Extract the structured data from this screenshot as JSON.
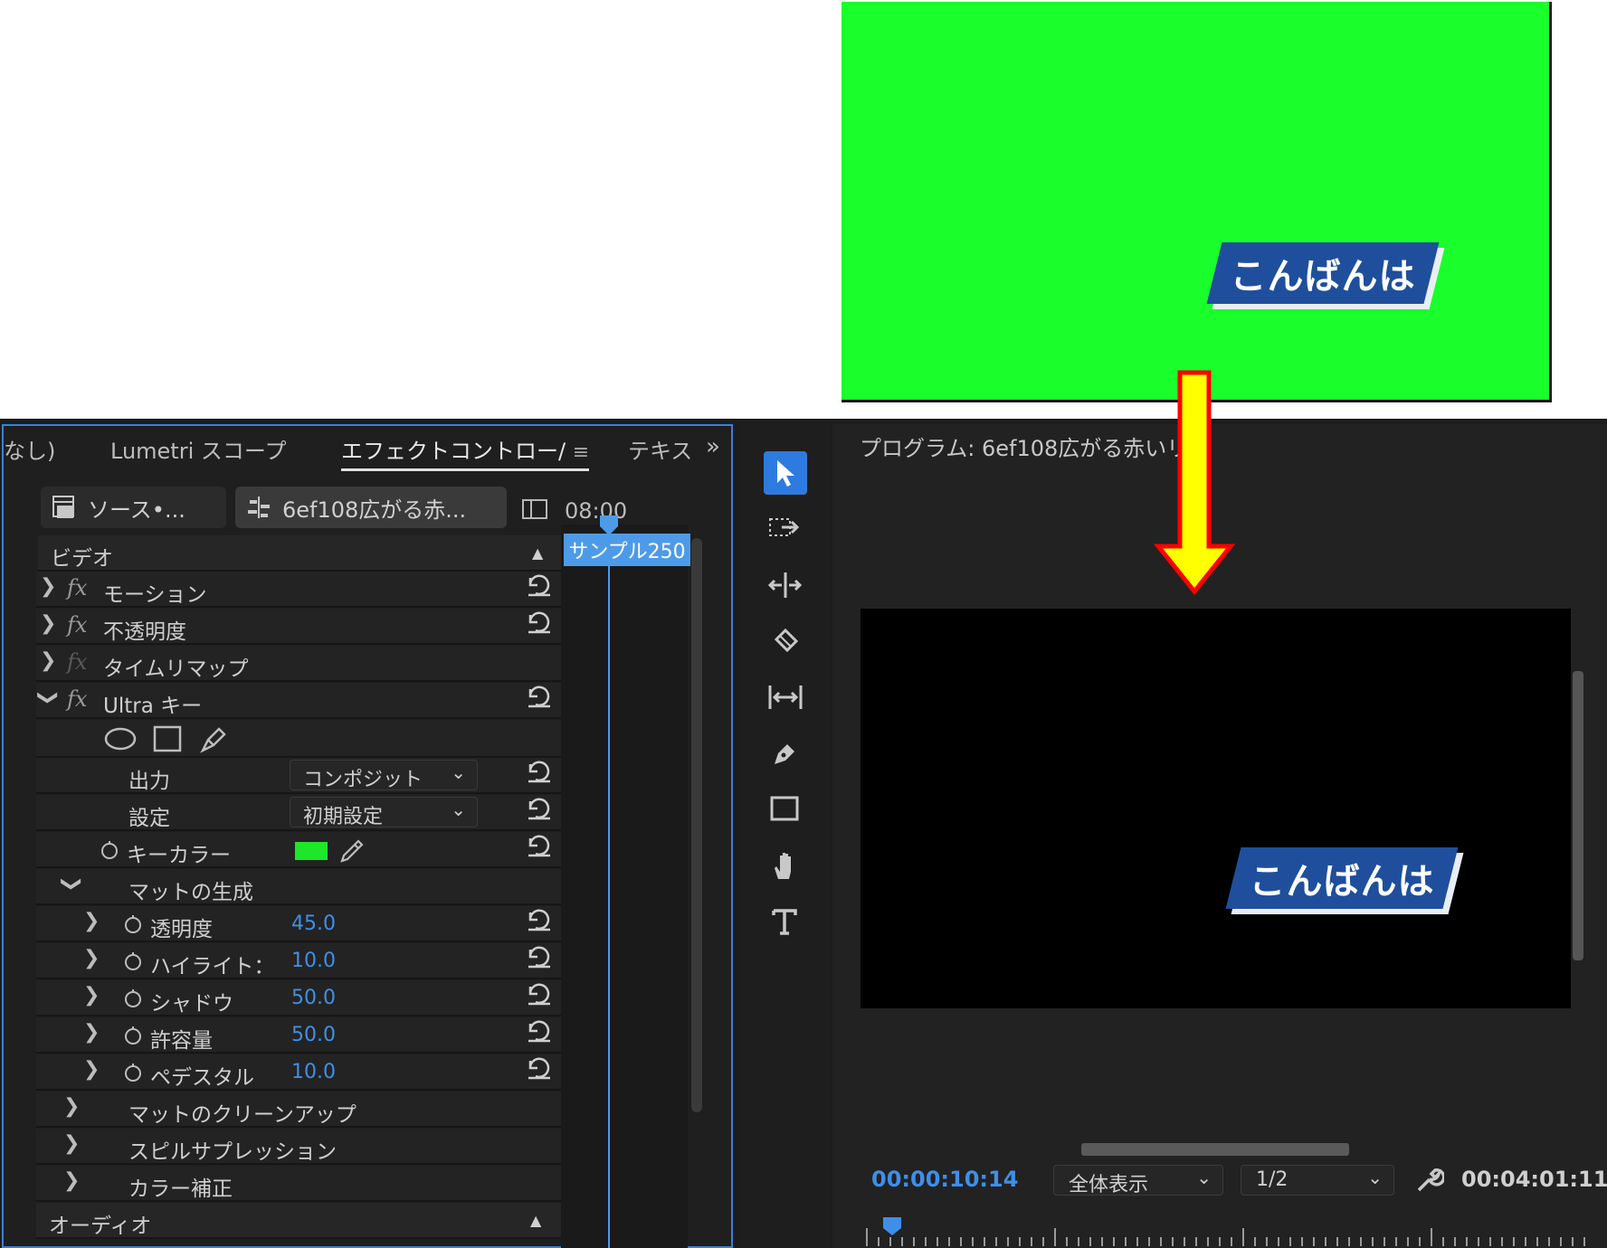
{
  "preview": {
    "title_text": "こんばんは",
    "background_color": "#1aff2b"
  },
  "effect_panel": {
    "tabs": [
      "なし)",
      "Lumetri スコープ",
      "エフェクトコントロー/",
      "テキス"
    ],
    "tab_menu": "≡",
    "overflow": "»",
    "source_label": "ソース•...",
    "clip_label": "6ef108広がる赤...",
    "timecode_ruler": "08:00",
    "clip_bar_label": "サンプル250",
    "section_video": "ビデオ",
    "section_audio": "オーディオ",
    "effects": {
      "motion": "モーション",
      "opacity": "不透明度",
      "time_remap": "タイムリマップ",
      "ultra_key": "Ultra キー"
    },
    "ultra_key": {
      "output_label": "出力",
      "output_value": "コンポジット",
      "setting_label": "設定",
      "setting_value": "初期設定",
      "key_color_label": "キーカラー",
      "key_color": "#1ee62b",
      "matte_generation": "マットの生成",
      "params": [
        {
          "label": "透明度",
          "value": "45.0"
        },
        {
          "label": "ハイライト：",
          "value": "10.0"
        },
        {
          "label": "シャドウ",
          "value": "50.0"
        },
        {
          "label": "許容量",
          "value": "50.0"
        },
        {
          "label": "ペデスタル",
          "value": "10.0"
        }
      ],
      "matte_cleanup": "マットのクリーンアップ",
      "spill_suppression": "スピルサプレッション",
      "color_correction": "カラー補正"
    }
  },
  "tools": [
    "selection-tool",
    "track-select-tool",
    "ripple-edit-tool",
    "razor-tool",
    "slip-tool",
    "pen-tool",
    "rectangle-tool",
    "hand-tool",
    "type-tool"
  ],
  "program": {
    "title": "プログラム: 6ef108広がる赤いリ",
    "menu": "≡",
    "lower_third_text": "こんばんは",
    "timecode_current": "00:00:10:14",
    "zoom": "全体表示",
    "resolution": "1/2",
    "timecode_total": "00:04:01:11"
  },
  "colors": {
    "accent_blue": "#3f8fe8",
    "arrow_fill": "#ffff00",
    "arrow_outline": "#ff0000",
    "lower_third_blue": "#1f4f9c"
  }
}
